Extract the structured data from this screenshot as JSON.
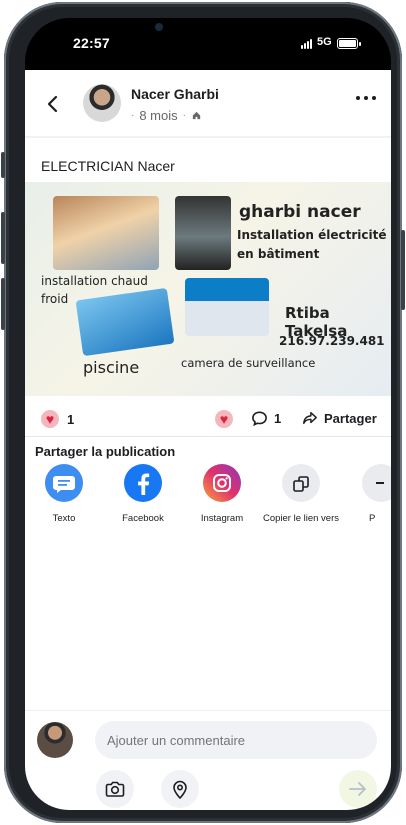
{
  "status_bar": {
    "time": "22:57",
    "network": "5G"
  },
  "post": {
    "author": "Nacer Gharbi",
    "age": "8 mois",
    "text": "ELECTRICIAN Nacer",
    "image": {
      "title": "gharbi nacer",
      "line1": "Installation électricité",
      "line2": "en bâtiment",
      "heating": "installation chaud",
      "heating2": "froid",
      "pool": "piscine",
      "camera": "camera de surveillance",
      "city": "Rtiba Takelsa",
      "phone": "216.97.239.481"
    }
  },
  "reactions": {
    "like_count": "1",
    "comment_count": "1",
    "share_label": "Partager"
  },
  "share": {
    "title": "Partager la publication",
    "options": [
      {
        "label": "Texto",
        "icon": "message-icon",
        "color": "#3d8ef0"
      },
      {
        "label": "Facebook",
        "icon": "facebook-icon",
        "color": "#1877f2"
      },
      {
        "label": "Instagram",
        "icon": "instagram-icon",
        "color": "#dc2f6d"
      },
      {
        "label": "Copier le lien vers",
        "icon": "copy-icon",
        "color": "#e4e6eb"
      },
      {
        "label": "P",
        "icon": "more-share-icon",
        "color": "#e4e6eb"
      }
    ]
  },
  "composer": {
    "placeholder": "Ajouter un commentaire"
  },
  "colors": {
    "accent": "#1877f2",
    "like": "#e41e3f"
  }
}
